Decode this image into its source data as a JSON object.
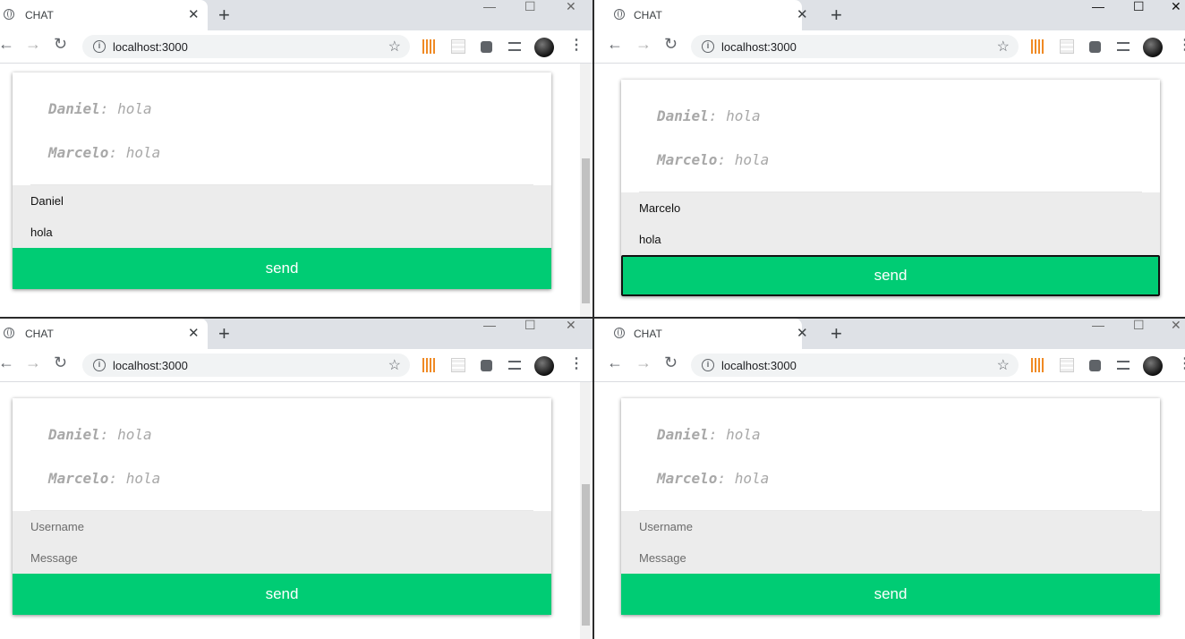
{
  "browser": {
    "tab_title": "CHAT",
    "tab_close": "✕",
    "new_tab": "+",
    "url": "localhost:3000",
    "win_min": "—",
    "win_max": "☐",
    "win_close": "✕",
    "back": "←",
    "forward": "→",
    "reload": "↻",
    "star": "☆",
    "menu": "⋮",
    "info": "i"
  },
  "chat": {
    "messages": [
      {
        "user": "Daniel",
        "text": "hola"
      },
      {
        "user": "Marcelo",
        "text": "hola"
      }
    ],
    "separator": ": ",
    "send_label": "send",
    "username_placeholder": "Username",
    "message_placeholder": "Message"
  },
  "windows": [
    {
      "username_value": "Daniel",
      "message_value": "hola"
    },
    {
      "username_value": "Marcelo",
      "message_value": "hola"
    },
    {
      "username_value": "",
      "message_value": ""
    },
    {
      "username_value": "",
      "message_value": ""
    }
  ],
  "colors": {
    "send_button": "#00cc74",
    "tab_bar": "#dee1e6",
    "input_bg": "#ececec",
    "message_text": "#a8a8a8"
  },
  "icons": [
    "globe-icon",
    "close-icon",
    "plus-icon",
    "back-arrow-icon",
    "forward-arrow-icon",
    "reload-icon",
    "info-icon",
    "star-icon",
    "extension-icon",
    "avatar",
    "kebab-menu-icon"
  ]
}
